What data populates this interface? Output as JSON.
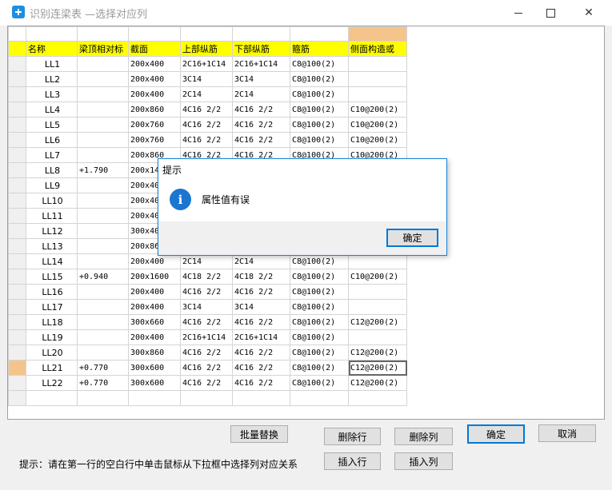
{
  "window": {
    "title": "识别连梁表 —选择对应列"
  },
  "columns": [
    "名称",
    "梁顶相对标",
    "截面",
    "上部纵筋",
    "下部纵筋",
    "箍筋",
    "侧面构造或"
  ],
  "rows": [
    [
      "LL1",
      "",
      "200x400",
      "2C16+1C14",
      "2C16+1C14",
      "C8@100(2)",
      ""
    ],
    [
      "LL2",
      "",
      "200x400",
      "3C14",
      "3C14",
      "C8@100(2)",
      ""
    ],
    [
      "LL3",
      "",
      "200x400",
      "2C14",
      "2C14",
      "C8@100(2)",
      ""
    ],
    [
      "LL4",
      "",
      "200x860",
      "4C16 2/2",
      "4C16 2/2",
      "C8@100(2)",
      "C10@200(2)"
    ],
    [
      "LL5",
      "",
      "200x760",
      "4C16 2/2",
      "4C16 2/2",
      "C8@100(2)",
      "C10@200(2)"
    ],
    [
      "LL6",
      "",
      "200x760",
      "4C16 2/2",
      "4C16 2/2",
      "C8@100(2)",
      "C10@200(2)"
    ],
    [
      "LL7",
      "",
      "200x860",
      "4C16 2/2",
      "4C16 2/2",
      "C8@100(2)",
      "C10@200(2)"
    ],
    [
      "LL8",
      "+1.790",
      "200x14",
      "",
      "",
      "",
      ""
    ],
    [
      "LL9",
      "",
      "200x40",
      "",
      "",
      "",
      ""
    ],
    [
      "LL10",
      "",
      "200x40",
      "",
      "",
      "",
      ""
    ],
    [
      "LL11",
      "",
      "200x40",
      "",
      "",
      "",
      ""
    ],
    [
      "LL12",
      "",
      "300x40",
      "",
      "",
      "",
      ""
    ],
    [
      "LL13",
      "",
      "200x86",
      "",
      "",
      "",
      ""
    ],
    [
      "LL14",
      "",
      "200x400",
      "2C14",
      "2C14",
      "C8@100(2)",
      ""
    ],
    [
      "LL15",
      "+0.940",
      "200x1600",
      "4C18 2/2",
      "4C18 2/2",
      "C8@100(2)",
      "C10@200(2)"
    ],
    [
      "LL16",
      "",
      "200x400",
      "4C16 2/2",
      "4C16 2/2",
      "C8@100(2)",
      ""
    ],
    [
      "LL17",
      "",
      "200x400",
      "3C14",
      "3C14",
      "C8@100(2)",
      ""
    ],
    [
      "LL18",
      "",
      "300x660",
      "4C16 2/2",
      "4C16 2/2",
      "C8@100(2)",
      "C12@200(2)"
    ],
    [
      "LL19",
      "",
      "200x400",
      "2C16+1C14",
      "2C16+1C14",
      "C8@100(2)",
      ""
    ],
    [
      "LL20",
      "",
      "300x860",
      "4C16 2/2",
      "4C16 2/2",
      "C8@100(2)",
      "C12@200(2)"
    ],
    [
      "LL21",
      "+0.770",
      "300x600",
      "4C16 2/2",
      "4C16 2/2",
      "C8@100(2)",
      "C12@200(2)"
    ],
    [
      "LL22",
      "+0.770",
      "300x600",
      "4C16 2/2",
      "4C16 2/2",
      "C8@100(2)",
      "C12@200(2)"
    ],
    [
      "",
      "",
      "",
      "",
      "",
      "",
      ""
    ]
  ],
  "selected_row": 20,
  "hint": "提示：请在第一行的空白行中单击鼠标从下拉框中选择列对应关系",
  "buttons": {
    "batch_replace": "批量替换",
    "delete_row": "删除行",
    "delete_col": "删除列",
    "insert_row": "插入行",
    "insert_col": "插入列",
    "confirm": "确定",
    "cancel": "取消"
  },
  "dialog": {
    "title": "提示",
    "message": "属性值有误",
    "ok": "确定",
    "icon": "info-icon"
  },
  "colors": {
    "header": "#ffff00",
    "selected": "#f5c48a",
    "accent": "#0078d7"
  }
}
